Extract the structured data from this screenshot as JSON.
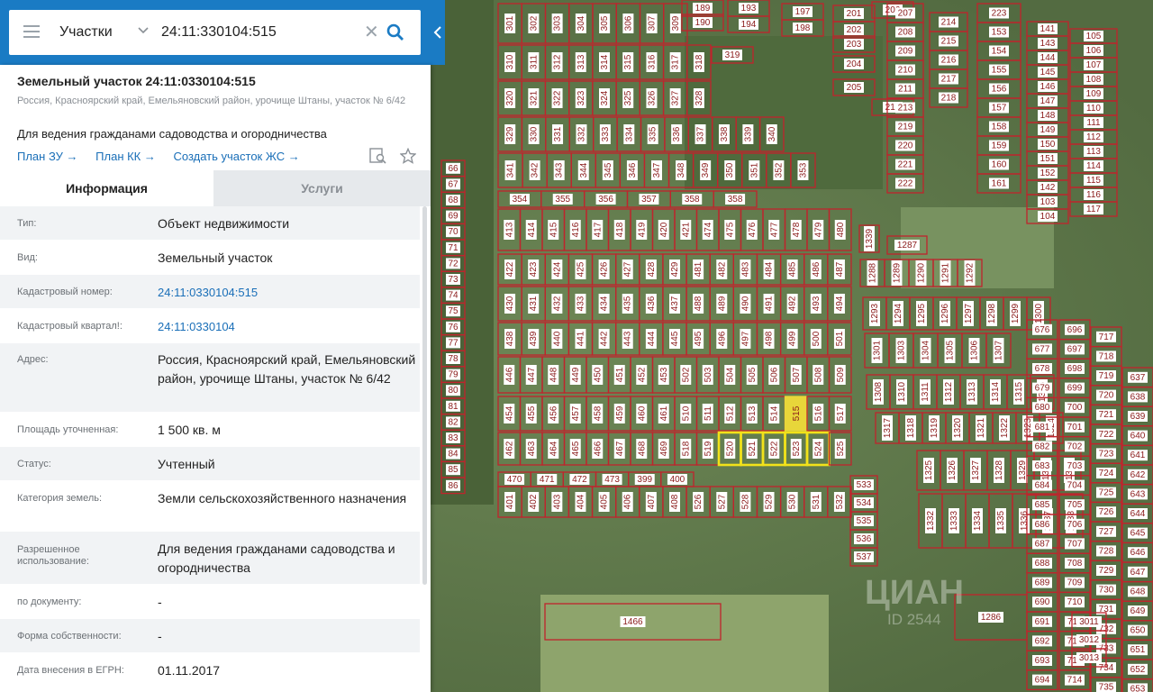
{
  "search": {
    "type_label": "Участки",
    "query": "24:11:330104:515"
  },
  "card": {
    "title": "Земельный участок 24:11:0330104:515",
    "address": "Россия, Красноярский край, Емельяновский район, урочище Штаны, участок № 6/42",
    "purpose": "Для ведения гражданами садоводства и огородничества",
    "links": [
      "План ЗУ →",
      "План КК →",
      "Создать участок ЖС →"
    ]
  },
  "tabs": [
    "Информация",
    "Услуги"
  ],
  "info_rows": [
    {
      "label": "Тип:",
      "value": "Объект недвижимости"
    },
    {
      "label": "Вид:",
      "value": "Земельный участок"
    },
    {
      "label": "Кадастровый номер:",
      "value": "24:11:0330104:515"
    },
    {
      "label": "Кадастровый квартал!:",
      "value": "24:11:0330104"
    },
    {
      "label": "Адрес:",
      "value": "Россия, Красноярский край, Емельяновский район, урочище Штаны, участок № 6/42"
    },
    {
      "label": "Площадь уточненная:",
      "value": "1 500 кв. м"
    },
    {
      "label": "Статус:",
      "value": "Учтенный"
    },
    {
      "label": "Категория земель:",
      "value": "Земли сельскохозяйственного назначения"
    },
    {
      "label": "Разрешенное использование:",
      "value": "Для ведения гражданами садоводства и огородничества"
    },
    {
      "label": "по документу:",
      "value": "-"
    },
    {
      "label": "Форма собственности:",
      "value": "-"
    },
    {
      "label": "Дата внесения в ЕГРН:",
      "value": "01.11.2017"
    }
  ],
  "map": {
    "selected_plot": "515",
    "highlighted_plots": [
      "520",
      "521",
      "522",
      "523",
      "524"
    ],
    "left_column": [
      "66",
      "67",
      "68",
      "69",
      "70",
      "71",
      "72",
      "73",
      "74",
      "75",
      "76",
      "77",
      "78",
      "79",
      "80",
      "81",
      "82",
      "83",
      "84",
      "85",
      "86"
    ],
    "grid_rows": [
      [
        "301",
        "302",
        "303",
        "304",
        "305",
        "306",
        "307",
        "309"
      ],
      [
        "310",
        "311",
        "312",
        "313",
        "314",
        "315",
        "316",
        "317",
        "318"
      ],
      [
        "320",
        "321",
        "322",
        "323",
        "324",
        "325",
        "326",
        "327",
        "328"
      ],
      [
        "329",
        "330",
        "331",
        "332",
        "333",
        "334",
        "335",
        "336",
        "337",
        "338",
        "339",
        "340"
      ],
      [
        "341",
        "342",
        "343",
        "344",
        "345",
        "346",
        "347",
        "348",
        "349",
        "350",
        "351",
        "352",
        "353"
      ],
      [
        "354",
        "355",
        "356",
        "357",
        "358",
        "358"
      ],
      [
        "413",
        "414",
        "415",
        "416",
        "417",
        "418",
        "419",
        "420",
        "421",
        "474",
        "475",
        "476",
        "477",
        "478",
        "479",
        "480"
      ],
      [
        "422",
        "423",
        "424",
        "425",
        "426",
        "427",
        "428",
        "429",
        "481",
        "482",
        "483",
        "484",
        "485",
        "486",
        "487"
      ],
      [
        "430",
        "431",
        "432",
        "433",
        "434",
        "435",
        "436",
        "437",
        "488",
        "489",
        "490",
        "491",
        "492",
        "493",
        "494"
      ],
      [
        "438",
        "439",
        "440",
        "441",
        "442",
        "443",
        "444",
        "445",
        "495",
        "496",
        "497",
        "498",
        "499",
        "500",
        "501"
      ],
      [
        "446",
        "447",
        "448",
        "449",
        "450",
        "451",
        "452",
        "453",
        "502",
        "503",
        "504",
        "505",
        "506",
        "507",
        "508",
        "509"
      ],
      [
        "454",
        "455",
        "456",
        "457",
        "458",
        "459",
        "460",
        "461",
        "510",
        "511",
        "512",
        "513",
        "514",
        "515",
        "516",
        "517"
      ],
      [
        "462",
        "463",
        "464",
        "465",
        "466",
        "467",
        "468",
        "469",
        "518",
        "519",
        "520",
        "521",
        "522",
        "523",
        "524",
        "525"
      ],
      [
        "470",
        "471",
        "472",
        "473",
        "399",
        "400"
      ],
      [
        "401",
        "402",
        "403",
        "404",
        "405",
        "406",
        "407",
        "408",
        "526",
        "527",
        "528",
        "529",
        "530",
        "531",
        "532"
      ]
    ],
    "top_cluster": [
      "189",
      "193",
      "197",
      "201",
      "190",
      "194",
      "198",
      "202",
      "203",
      "204",
      "205",
      "206",
      "212",
      "319"
    ],
    "col_208": [
      "207",
      "208",
      "209",
      "210",
      "211",
      "213",
      "219",
      "220",
      "221",
      "222"
    ],
    "col_214": [
      "214",
      "215",
      "216",
      "217",
      "218"
    ],
    "col_153": [
      "223",
      "153",
      "154",
      "155",
      "156",
      "157",
      "158",
      "159",
      "160",
      "161"
    ],
    "col_141": [
      "141",
      "143",
      "144",
      "145",
      "146",
      "147",
      "148",
      "149",
      "150",
      "151",
      "152",
      "142",
      "103",
      "104"
    ],
    "col_105": [
      "105",
      "106",
      "107",
      "108",
      "109",
      "110",
      "111",
      "112",
      "113",
      "114",
      "115",
      "116",
      "117"
    ],
    "mid_cluster": [
      "1339",
      "1287",
      "1288",
      "1289",
      "1290",
      "1291",
      "1292",
      "1293",
      "1294",
      "1295",
      "1296",
      "1297",
      "1298",
      "1299",
      "1300",
      "1301",
      "1303",
      "1304",
      "1305",
      "1306",
      "1307",
      "1308",
      "1310",
      "1311",
      "1312",
      "1313",
      "1314",
      "1315",
      "1316",
      "1317",
      "1318",
      "1319",
      "1320",
      "1321",
      "1322",
      "1323",
      "1324",
      "1325",
      "1326",
      "1327",
      "1328",
      "1329",
      "1330",
      "1331",
      "1332",
      "1333",
      "1334",
      "1335",
      "1336",
      "1337",
      "1338"
    ],
    "right_col_a": [
      "676",
      "677",
      "678",
      "679",
      "680",
      "681",
      "682",
      "683",
      "684",
      "685",
      "686",
      "687",
      "688",
      "689",
      "690",
      "691",
      "692",
      "693",
      "694"
    ],
    "right_col_b": [
      "696",
      "697",
      "698",
      "699",
      "700",
      "701",
      "702",
      "703",
      "704",
      "705",
      "706",
      "707",
      "708",
      "709",
      "710",
      "711",
      "712",
      "713",
      "714"
    ],
    "right_col_c": [
      "717",
      "718",
      "719",
      "720",
      "721",
      "722",
      "723",
      "724",
      "725",
      "726",
      "727",
      "728",
      "729",
      "730",
      "731",
      "732",
      "733",
      "734",
      "735"
    ],
    "right_col_d": [
      "637",
      "638",
      "639",
      "640",
      "641",
      "642",
      "643",
      "644",
      "645",
      "646",
      "647",
      "648",
      "649",
      "650",
      "651",
      "652",
      "653"
    ],
    "right_col_e": [
      "3011",
      "3012",
      "3013"
    ],
    "side_plots": [
      "533",
      "534",
      "535",
      "536",
      "537"
    ],
    "big_plots": [
      "1466",
      "1286"
    ],
    "watermark": "ЦИАН",
    "watermark_id": "ID 2544"
  }
}
